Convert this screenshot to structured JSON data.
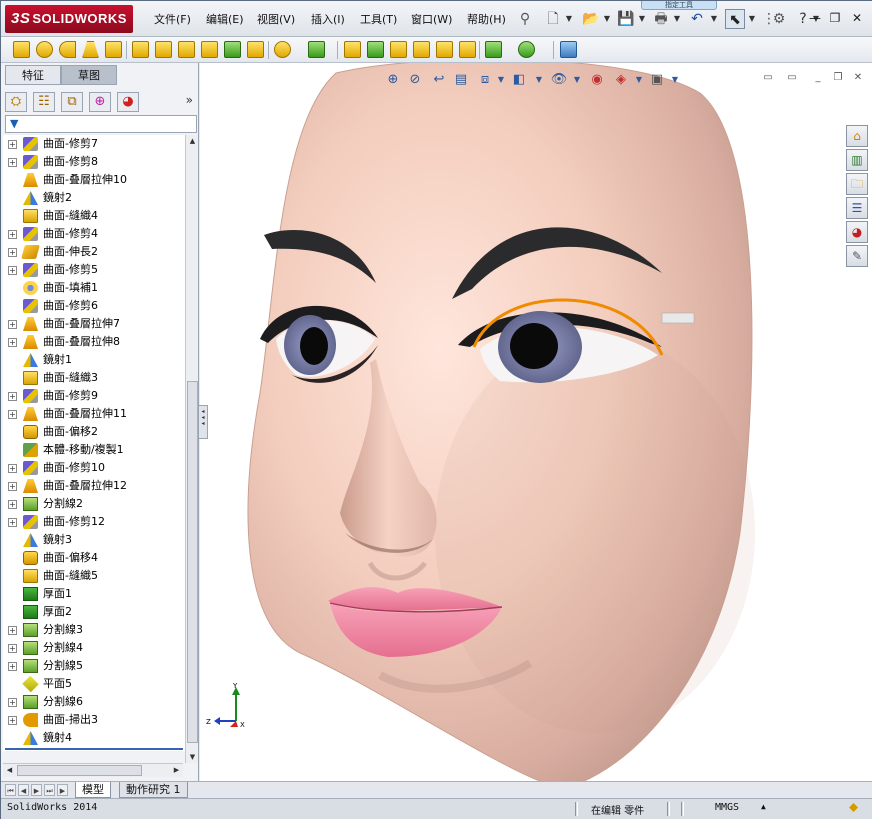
{
  "app": {
    "logo": "SOLIDWORKS",
    "logo_prefix": "3S"
  },
  "menu": [
    "文件(F)",
    "编辑(E)",
    "视图(V)",
    "插入(I)",
    "工具(T)",
    "窗口(W)",
    "帮助(H)"
  ],
  "search_tip": "指定工具",
  "left_panel": {
    "tabs": [
      "特征",
      "草图"
    ],
    "active_tab": "草图",
    "more": "»"
  },
  "tree": [
    {
      "label": "曲面-修剪7",
      "icon": "trim",
      "expandable": true
    },
    {
      "label": "曲面-修剪8",
      "icon": "trim",
      "expandable": true
    },
    {
      "label": "曲面-叠層拉伸10",
      "icon": "loft",
      "expandable": false
    },
    {
      "label": "鏡射2",
      "icon": "mirror",
      "expandable": false
    },
    {
      "label": "曲面-縫織4",
      "icon": "knit",
      "expandable": false
    },
    {
      "label": "曲面-修剪4",
      "icon": "trim",
      "expandable": true
    },
    {
      "label": "曲面-伸長2",
      "icon": "extend",
      "expandable": true
    },
    {
      "label": "曲面-修剪5",
      "icon": "trim",
      "expandable": true
    },
    {
      "label": "曲面-填補1",
      "icon": "fill",
      "expandable": false
    },
    {
      "label": "曲面-修剪6",
      "icon": "trim",
      "expandable": false
    },
    {
      "label": "曲面-叠層拉伸7",
      "icon": "loft",
      "expandable": true
    },
    {
      "label": "曲面-叠層拉伸8",
      "icon": "loft",
      "expandable": true
    },
    {
      "label": "鏡射1",
      "icon": "mirror",
      "expandable": false
    },
    {
      "label": "曲面-縫織3",
      "icon": "knit",
      "expandable": false
    },
    {
      "label": "曲面-修剪9",
      "icon": "trim",
      "expandable": true
    },
    {
      "label": "曲面-叠層拉伸11",
      "icon": "loft",
      "expandable": true
    },
    {
      "label": "曲面-偏移2",
      "icon": "offset",
      "expandable": false
    },
    {
      "label": "本體-移動/複製1",
      "icon": "move",
      "expandable": false
    },
    {
      "label": "曲面-修剪10",
      "icon": "trim",
      "expandable": true
    },
    {
      "label": "曲面-叠層拉伸12",
      "icon": "loft",
      "expandable": true
    },
    {
      "label": "分割線2",
      "icon": "split",
      "expandable": true
    },
    {
      "label": "曲面-修剪12",
      "icon": "trim",
      "expandable": true
    },
    {
      "label": "鏡射3",
      "icon": "mirror",
      "expandable": false
    },
    {
      "label": "曲面-偏移4",
      "icon": "offset",
      "expandable": false
    },
    {
      "label": "曲面-縫織5",
      "icon": "knit",
      "expandable": false
    },
    {
      "label": "厚面1",
      "icon": "thick",
      "expandable": false
    },
    {
      "label": "厚面2",
      "icon": "thick",
      "expandable": false
    },
    {
      "label": "分割線3",
      "icon": "split",
      "expandable": true
    },
    {
      "label": "分割線4",
      "icon": "split",
      "expandable": true
    },
    {
      "label": "分割線5",
      "icon": "split",
      "expandable": true
    },
    {
      "label": "平面5",
      "icon": "plane",
      "expandable": false
    },
    {
      "label": "分割線6",
      "icon": "split",
      "expandable": true
    },
    {
      "label": "曲面-掃出3",
      "icon": "sweep",
      "expandable": true
    },
    {
      "label": "鏡射4",
      "icon": "mirror",
      "expandable": false
    }
  ],
  "triad": {
    "x": "X",
    "y": "Y",
    "z": "Z"
  },
  "bottom_tabs": [
    "模型",
    "動作研究 1"
  ],
  "status": {
    "app": "SolidWorks 2014",
    "mode": "在编辑 零件",
    "units": "MMGS",
    "units_arrow": "▲"
  },
  "colors": {
    "skin": "#f4c9b8",
    "lip": "#f07fa0",
    "iris": "#7a7ea8",
    "sketch_curve": "#f08a00"
  }
}
